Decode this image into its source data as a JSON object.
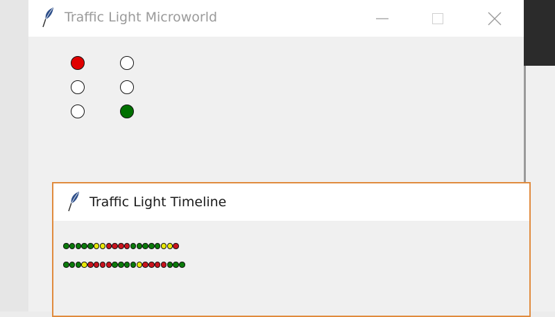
{
  "microworld_window": {
    "title": "Traffic Light Microworld",
    "app_icon": "feather-icon",
    "controls": [
      "minimize-icon",
      "maximize-icon",
      "close-icon"
    ],
    "lights": {
      "left": [
        "red",
        "off",
        "off"
      ],
      "right": [
        "off",
        "off",
        "green"
      ]
    }
  },
  "timeline_window": {
    "title": "Traffic Light Timeline",
    "app_icon": "feather-icon",
    "rows": [
      [
        "green",
        "green",
        "green",
        "green",
        "green",
        "yellow",
        "yellow",
        "red",
        "red",
        "red",
        "red",
        "green",
        "green",
        "green",
        "green",
        "green",
        "yellow",
        "yellow",
        "red"
      ],
      [
        "green",
        "green",
        "green",
        "yellow",
        "red",
        "red",
        "red",
        "red",
        "green",
        "green",
        "green",
        "green",
        "yellow",
        "red",
        "red",
        "red",
        "red",
        "green",
        "green",
        "green"
      ]
    ]
  },
  "colors": {
    "red": "#e00000",
    "green": "#007000",
    "yellow": "#f2e400",
    "off": "#ffffff",
    "timeline_red": "#c8141e",
    "timeline_green": "#0a7a0a",
    "timeline_yellow": "#e8e80a",
    "accent_border": "#e08a3c"
  }
}
